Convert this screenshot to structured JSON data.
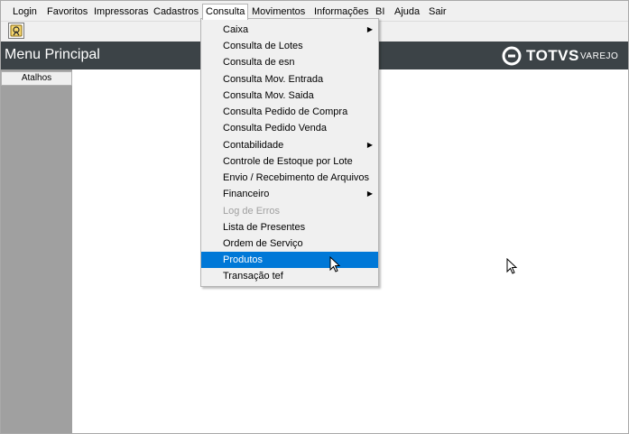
{
  "menubar": {
    "items": [
      {
        "label": "Login"
      },
      {
        "label": "Favoritos"
      },
      {
        "label": "Impressoras"
      },
      {
        "label": "Cadastros"
      },
      {
        "label": "Consulta"
      },
      {
        "label": "Movimentos"
      },
      {
        "label": "Informações"
      },
      {
        "label": "BI"
      },
      {
        "label": "Ajuda"
      },
      {
        "label": "Sair"
      }
    ],
    "active": "Consulta"
  },
  "toolbar": {
    "icon": "shortcut-icon"
  },
  "header": {
    "title": "Menu Principal",
    "logo": {
      "brand": "TOTVS",
      "sub": "VAREJO"
    }
  },
  "sidebar": {
    "tab_label": "Atalhos"
  },
  "consulta_menu": {
    "items": [
      {
        "label": "Caixa",
        "submenu": true
      },
      {
        "label": "Consulta de Lotes"
      },
      {
        "label": "Consulta de esn"
      },
      {
        "label": "Consulta Mov. Entrada"
      },
      {
        "label": "Consulta Mov. Saida"
      },
      {
        "label": "Consulta Pedido de Compra"
      },
      {
        "label": "Consulta Pedido Venda"
      },
      {
        "label": "Contabilidade",
        "submenu": true
      },
      {
        "label": "Controle de Estoque por Lote"
      },
      {
        "label": "Envio / Recebimento de Arquivos"
      },
      {
        "label": "Financeiro",
        "submenu": true
      },
      {
        "label": "Log de Erros",
        "disabled": true
      },
      {
        "label": "Lista de Presentes"
      },
      {
        "label": "Ordem de Serviço"
      },
      {
        "label": "Produtos",
        "selected": true
      },
      {
        "label": "Transação tef"
      }
    ]
  },
  "colors": {
    "header_bg": "#3c4347",
    "selection": "#0078d7",
    "sidebar_bg": "#a0a0a0"
  }
}
